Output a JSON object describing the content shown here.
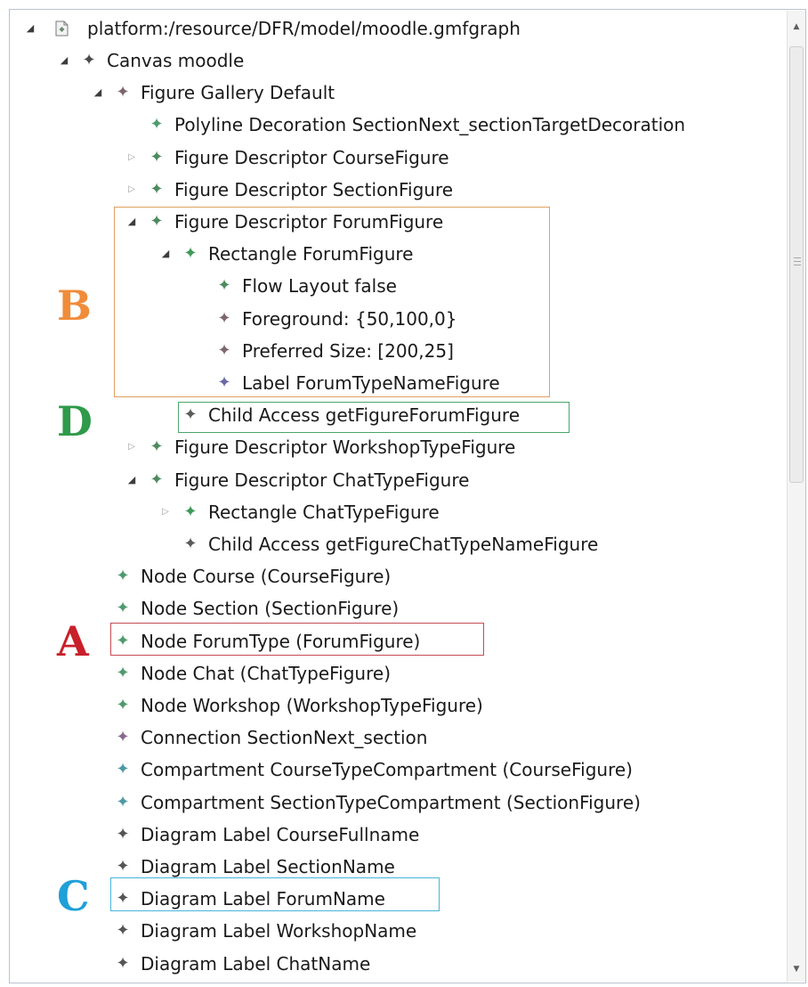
{
  "tree": {
    "root_label": "platform:/resource/DFR/model/moodle.gmfgraph",
    "root_icon": "gmfgraph-file-icon",
    "items": [
      {
        "label": "Canvas moodle",
        "toggle": "open",
        "icon": "diamond-node-icon",
        "color": "#4a4a4a"
      },
      {
        "label": "Figure Gallery Default",
        "toggle": "open",
        "icon": "diamond-node-icon",
        "color": "#7d6670"
      },
      {
        "label": "Polyline Decoration SectionNext_sectionTargetDecoration",
        "toggle": "none",
        "icon": "diamond-node-icon",
        "color": "#4f9a6e"
      },
      {
        "label": "Figure Descriptor CourseFigure",
        "toggle": "closed",
        "icon": "diamond-node-icon",
        "color": "#4f8a5e"
      },
      {
        "label": "Figure Descriptor SectionFigure",
        "toggle": "closed",
        "icon": "diamond-node-icon",
        "color": "#4f8a5e"
      },
      {
        "label": "Figure Descriptor ForumFigure",
        "toggle": "open",
        "icon": "diamond-node-icon",
        "color": "#4f8a5e"
      },
      {
        "label": "Rectangle ForumFigure",
        "toggle": "open",
        "icon": "diamond-node-icon",
        "color": "#3f9a58"
      },
      {
        "label": "Flow Layout false",
        "toggle": "none",
        "icon": "diamond-node-icon",
        "color": "#4f8a5e"
      },
      {
        "label": "Foreground: {50,100,0}",
        "toggle": "none",
        "icon": "diamond-node-icon",
        "color": "#7d6670"
      },
      {
        "label": "Preferred Size: [200,25]",
        "toggle": "none",
        "icon": "diamond-node-icon",
        "color": "#7d6670"
      },
      {
        "label": "Label ForumTypeNameFigure",
        "toggle": "none",
        "icon": "diamond-node-icon",
        "color": "#6a6aa8"
      },
      {
        "label": "Child Access getFigureForumFigure",
        "toggle": "none",
        "icon": "diamond-node-icon",
        "color": "#5a5a5a"
      },
      {
        "label": "Figure Descriptor WorkshopTypeFigure",
        "toggle": "closed",
        "icon": "diamond-node-icon",
        "color": "#4f8a5e"
      },
      {
        "label": "Figure Descriptor ChatTypeFigure",
        "toggle": "open",
        "icon": "diamond-node-icon",
        "color": "#4f8a5e"
      },
      {
        "label": "Rectangle ChatTypeFigure",
        "toggle": "closed",
        "icon": "diamond-node-icon",
        "color": "#3f9a58"
      },
      {
        "label": "Child Access getFigureChatTypeNameFigure",
        "toggle": "none",
        "icon": "diamond-node-icon",
        "color": "#5a5a5a"
      },
      {
        "label": "Node Course (CourseFigure)",
        "toggle": "none",
        "icon": "diamond-node-icon",
        "color": "#4f9a6e"
      },
      {
        "label": "Node Section (SectionFigure)",
        "toggle": "none",
        "icon": "diamond-node-icon",
        "color": "#4f9a6e"
      },
      {
        "label": "Node ForumType (ForumFigure)",
        "toggle": "none",
        "icon": "diamond-node-icon",
        "color": "#4f9a6e"
      },
      {
        "label": "Node Chat (ChatTypeFigure)",
        "toggle": "none",
        "icon": "diamond-node-icon",
        "color": "#4f9a6e"
      },
      {
        "label": "Node Workshop (WorkshopTypeFigure)",
        "toggle": "none",
        "icon": "diamond-node-icon",
        "color": "#4f9a6e"
      },
      {
        "label": "Connection SectionNext_section",
        "toggle": "none",
        "icon": "diamond-node-icon",
        "color": "#8a6a90"
      },
      {
        "label": "Compartment CourseTypeCompartment (CourseFigure)",
        "toggle": "none",
        "icon": "diamond-node-icon",
        "color": "#4e9aa4"
      },
      {
        "label": "Compartment SectionTypeCompartment (SectionFigure)",
        "toggle": "none",
        "icon": "diamond-node-icon",
        "color": "#4e9aa4"
      },
      {
        "label": "Diagram Label CourseFullname",
        "toggle": "none",
        "icon": "diamond-node-icon",
        "color": "#555555"
      },
      {
        "label": "Diagram Label SectionName",
        "toggle": "none",
        "icon": "diamond-node-icon",
        "color": "#555555"
      },
      {
        "label": "Diagram Label ForumName",
        "toggle": "none",
        "icon": "diamond-node-icon",
        "color": "#555555"
      },
      {
        "label": "Diagram Label WorkshopName",
        "toggle": "none",
        "icon": "diamond-node-icon",
        "color": "#555555"
      },
      {
        "label": "Diagram Label ChatName",
        "toggle": "none",
        "icon": "diamond-node-icon",
        "color": "#555555"
      }
    ]
  },
  "annotations": [
    {
      "letter": "B",
      "color": "#f08c3a"
    },
    {
      "letter": "D",
      "color": "#2e9a4a"
    },
    {
      "letter": "A",
      "color": "#c8202a"
    },
    {
      "letter": "C",
      "color": "#1ea0d8"
    }
  ],
  "scrollbar": {
    "up_icon": "scroll-up-arrow-icon",
    "down_icon": "scroll-down-arrow-icon"
  }
}
